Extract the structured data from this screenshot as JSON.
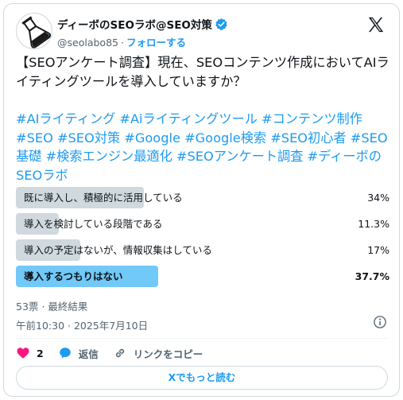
{
  "author": {
    "display_name": "ディーボのSEOラボ@SEO対策",
    "handle": "@seolabo85",
    "separator": "·",
    "follow_label": "フォローする",
    "verified_color": "#1d9bf0"
  },
  "tweet": {
    "question": "【SEOアンケート調査】現在、SEOコンテンツ作成においてAIライティングツールを導入していますか？",
    "hashtags": "#AIライティング #Aiライティングツール #コンテンツ制作 #SEO #SEO対策 #Google #Google検索 #SEO初心者 #SEO基礎 #検索エンジン最適化 #SEOアンケート調査 #ディーボのSEOラボ"
  },
  "poll": {
    "options": [
      {
        "label": "既に導入し、積極的に活用している",
        "percent_label": "34%",
        "percent": 34,
        "winner": false
      },
      {
        "label": "導入を検討している段階である",
        "percent_label": "11.3%",
        "percent": 11.3,
        "winner": false
      },
      {
        "label": "導入の予定はないが、情報収集はしている",
        "percent_label": "17%",
        "percent": 17,
        "winner": false
      },
      {
        "label": "導入するつもりはない",
        "percent_label": "37.7%",
        "percent": 37.7,
        "winner": true
      }
    ],
    "meta": "53票 · 最終結果",
    "bar_color": "#cfd9de",
    "winner_color": "#71c9f8"
  },
  "timestamp": "午前10:30 · 2025年7月10日",
  "actions": {
    "like_count": "2",
    "reply_label": "返信",
    "copy_link_label": "リンクをコピー",
    "like_color": "#f91880",
    "reply_color": "#1d9bf0"
  },
  "read_more_label": "Xでもっと読む",
  "icons": {
    "avatar": "flask-logo",
    "verified": "verified-badge-icon",
    "x_logo": "x-logo-icon",
    "info": "info-icon",
    "like": "heart-icon",
    "reply": "speech-bubble-icon",
    "link": "link-icon"
  }
}
